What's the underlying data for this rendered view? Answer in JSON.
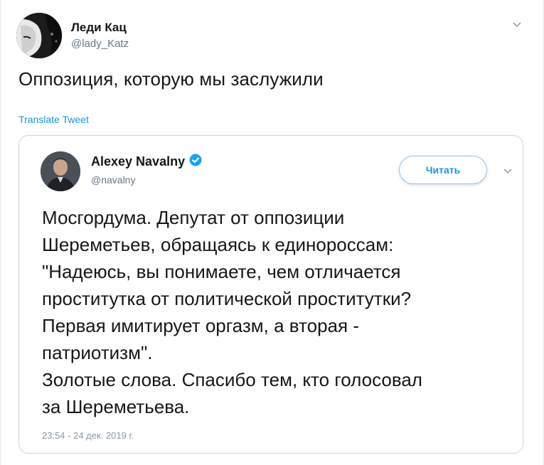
{
  "tweet": {
    "author_name": "Леди Кац",
    "author_handle": "@lady_Katz",
    "text": "Оппозиция, которую мы заслужили",
    "translate_label": "Translate Tweet",
    "menu_icon": "chevron-down-icon"
  },
  "quoted": {
    "author_name": "Alexey Navalny",
    "verified_icon": "verified-badge-icon",
    "author_handle": "@navalny",
    "follow_label": "Читать",
    "menu_icon": "chevron-down-icon",
    "lines": [
      "Мосгордума. Депутат от оппозиции",
      "Шереметьев, обращаясь к единороссам:",
      "\"Надеюсь, вы понимаете, чем отличается",
      "проститутка от политической проститутки?",
      "Первая имитирует оргазм, а вторая -",
      "патриотизм\".",
      "Золотые слова. Спасибо тем, кто голосовал",
      "за Шереметьева."
    ],
    "timestamp": "23:54 - 24 дек. 2019 г."
  },
  "colors": {
    "accent": "#1b95e0",
    "secondary_text": "#657786",
    "border": "#ccd6dd"
  }
}
